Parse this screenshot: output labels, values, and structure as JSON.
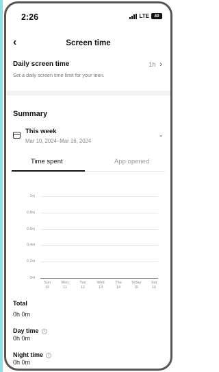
{
  "status_bar": {
    "time": "2:26",
    "network": "LTE",
    "battery": "40"
  },
  "header": {
    "title": "Screen time"
  },
  "daily_screen_time": {
    "title": "Daily screen time",
    "value": "1h",
    "description": "Set a daily screen time limit for your teen."
  },
  "summary": {
    "heading": "Summary",
    "period_title": "This week",
    "period_range": "Mar 10, 2024–Mar 16, 2024"
  },
  "tabs": [
    {
      "label": "Time spent",
      "active": true
    },
    {
      "label": "App opened",
      "active": false
    }
  ],
  "chart_data": {
    "type": "bar",
    "categories": [
      "Sun 10",
      "Mon 11",
      "Tue 12",
      "Wed 13",
      "Thu 14",
      "Today 15",
      "Sat 16"
    ],
    "category_lines": [
      [
        "Sun",
        "10"
      ],
      [
        "Mon",
        "11"
      ],
      [
        "Tue",
        "12"
      ],
      [
        "Wed",
        "13"
      ],
      [
        "Thu",
        "14"
      ],
      [
        "Today",
        "15"
      ],
      [
        "Sat",
        "16"
      ]
    ],
    "values": [
      0,
      0,
      0,
      0,
      0,
      0,
      0
    ],
    "y_ticks": [
      "1m",
      "0.8m",
      "0.6m",
      "0.4m",
      "0.2m",
      "0m"
    ],
    "ylim": [
      0,
      1
    ],
    "grid": true
  },
  "totals": {
    "total_label": "Total",
    "total_value": "0h 0m",
    "day_label": "Day time",
    "day_value": "0h 0m",
    "night_label": "Night time",
    "night_value": "0h 0m"
  }
}
